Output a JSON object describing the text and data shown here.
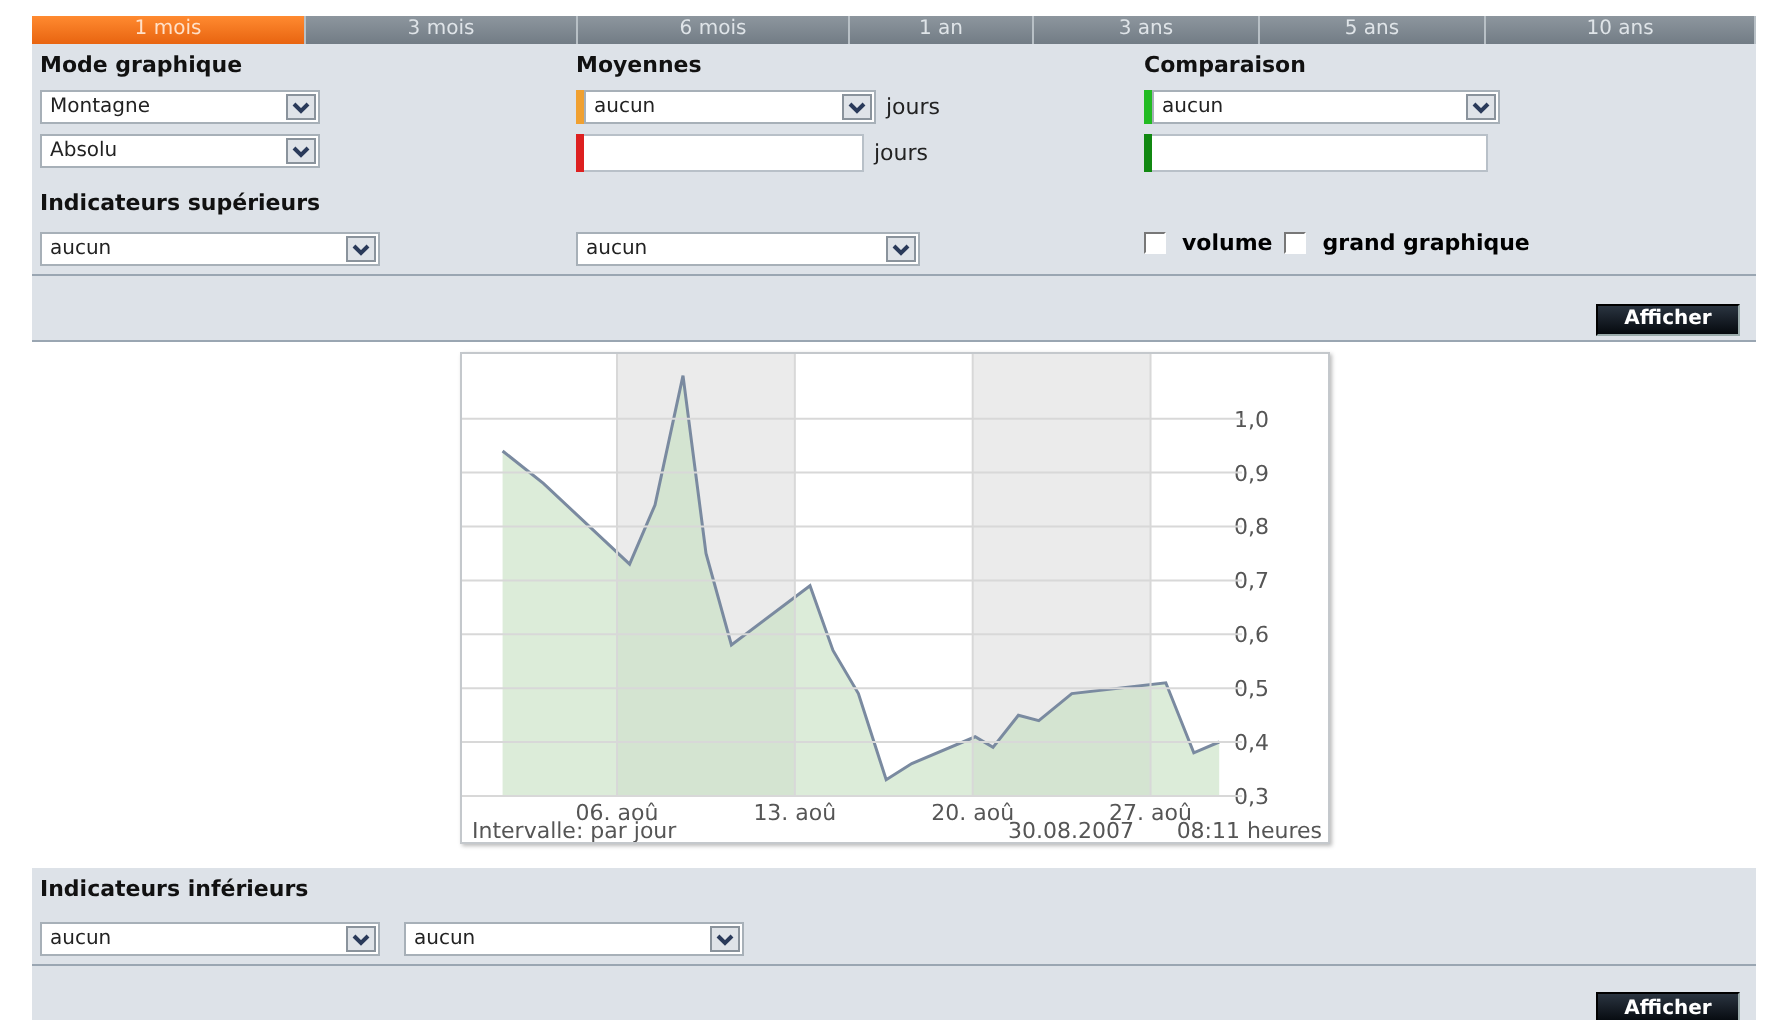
{
  "tabs": [
    {
      "label": "1 mois",
      "selected": true
    },
    {
      "label": "3 mois",
      "selected": false
    },
    {
      "label": "6 mois",
      "selected": false
    },
    {
      "label": "1 an",
      "selected": false
    },
    {
      "label": "3 ans",
      "selected": false
    },
    {
      "label": "5 ans",
      "selected": false
    },
    {
      "label": "10 ans",
      "selected": false
    }
  ],
  "mode_graphique": {
    "label": "Mode graphique",
    "selects": [
      "Montagne",
      "Absolu"
    ]
  },
  "moyennes": {
    "label": "Moyennes",
    "rows": [
      {
        "kind": "select",
        "value": "aucun",
        "unit": "jours",
        "color": "#f0a030"
      },
      {
        "kind": "input",
        "unit": "jours",
        "color": "#dd2020"
      }
    ]
  },
  "comparaison": {
    "label": "Comparaison",
    "rows": [
      {
        "kind": "select",
        "value": "aucun",
        "color": "#22bb22"
      },
      {
        "kind": "input",
        "color": "#118811"
      }
    ]
  },
  "indicateurs_superieurs": {
    "label": "Indicateurs supérieurs",
    "selects": [
      "aucun",
      "aucun"
    ]
  },
  "options": [
    {
      "label": "volume",
      "checked": false
    },
    {
      "label": "grand graphique",
      "checked": false
    }
  ],
  "top_button": "Afficher",
  "chart": {
    "chart_data": {
      "type": "area",
      "grid": true,
      "x": [
        1.5,
        3.1,
        6.5,
        7.5,
        8.6,
        9.5,
        10.5,
        13.6,
        14.5,
        15.5,
        16.6,
        17.6,
        20.1,
        20.8,
        21.8,
        22.6,
        23.9,
        27.6,
        28.7,
        29.7
      ],
      "xlim": [
        -0.1,
        30.6
      ],
      "ylim": [
        0.3,
        1.12
      ],
      "series": [
        {
          "color": "#7a8aa0",
          "values": [
            0.94,
            0.88,
            0.73,
            0.84,
            1.08,
            0.75,
            0.58,
            0.69,
            0.57,
            0.49,
            0.33,
            0.36,
            0.41,
            0.39,
            0.45,
            0.44,
            0.49,
            0.51,
            0.38,
            0.4
          ]
        }
      ],
      "xticks": [
        {
          "value": 6,
          "label": "06. aoû"
        },
        {
          "value": 13,
          "label": "13. aoû"
        },
        {
          "value": 20,
          "label": "20. aoû"
        },
        {
          "value": 27,
          "label": "27. aoû"
        }
      ],
      "yticks": [
        {
          "value": 0.3,
          "label": "0,3"
        },
        {
          "value": 0.4,
          "label": "0,4"
        },
        {
          "value": 0.5,
          "label": "0,5"
        },
        {
          "value": 0.6,
          "label": "0,6"
        },
        {
          "value": 0.7,
          "label": "0,7"
        },
        {
          "value": 0.8,
          "label": "0,8"
        },
        {
          "value": 0.9,
          "label": "0,9"
        },
        {
          "value": 1.0,
          "label": "1,0"
        }
      ]
    },
    "interval": "Intervalle: par jour",
    "date": "30.08.2007",
    "time": "08:11 heures"
  },
  "indicateurs_inferieurs": {
    "label": "Indicateurs inférieurs",
    "selects": [
      "aucun",
      "aucun"
    ]
  },
  "bottom_button": "Afficher"
}
